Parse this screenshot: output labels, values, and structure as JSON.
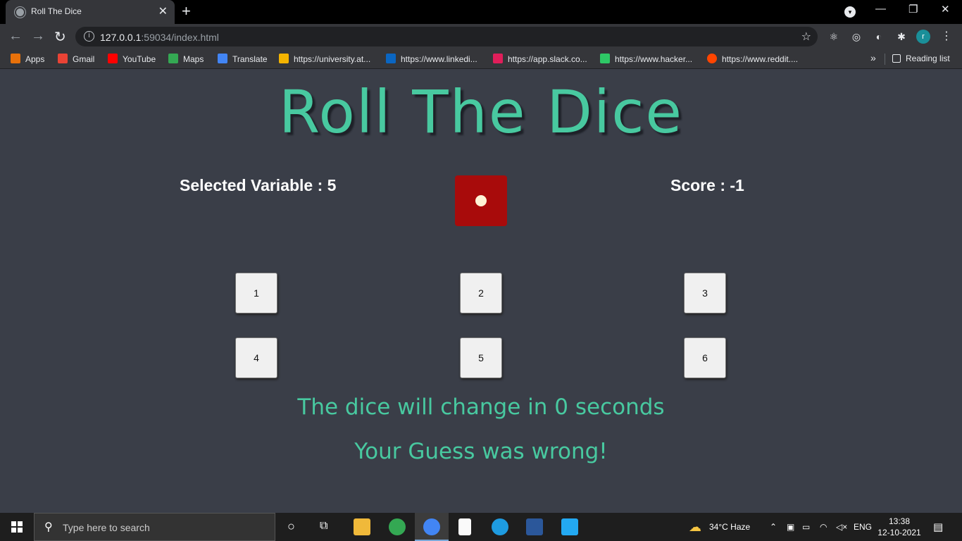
{
  "browser": {
    "tab_title": "Roll The Dice",
    "tab_close": "✕",
    "new_tab": "+",
    "url_host": "127.0.0.1",
    "url_rest": ":59034/index.html",
    "avatar_letter": "r",
    "reading_list": "Reading list",
    "overflow": "»",
    "bookmarks": [
      {
        "label": "Apps",
        "icon": "apps-grid-icon",
        "color": "#e8710a"
      },
      {
        "label": "Gmail",
        "icon": "gmail-icon",
        "color": "#ea4335"
      },
      {
        "label": "YouTube",
        "icon": "youtube-icon",
        "color": "#ff0000"
      },
      {
        "label": "Maps",
        "icon": "maps-icon",
        "color": "#34a853"
      },
      {
        "label": "Translate",
        "icon": "translate-icon",
        "color": "#4285f4"
      },
      {
        "label": "https://university.at...",
        "icon": "university-icon",
        "color": "#f4b400"
      },
      {
        "label": "https://www.linkedi...",
        "icon": "linkedin-icon",
        "color": "#0a66c2"
      },
      {
        "label": "https://app.slack.co...",
        "icon": "slack-icon",
        "color": "#e01e5a"
      },
      {
        "label": "https://www.hacker...",
        "icon": "hackerrank-icon",
        "color": "#2ec866"
      },
      {
        "label": "https://www.reddit....",
        "icon": "reddit-icon",
        "color": "#ff4500"
      }
    ]
  },
  "game": {
    "title": "Roll The Dice",
    "selected_variable": "Selected Variable : 5",
    "score": "Score : -1",
    "dice_value": 1,
    "buttons": [
      "1",
      "2",
      "3",
      "4",
      "5",
      "6"
    ],
    "timer_message": "The dice will change in 0 seconds",
    "result_message": "Your Guess was wrong!",
    "accent_color": "#48c9a0",
    "dice_color": "#a80b0b"
  },
  "taskbar": {
    "search_placeholder": "Type here to search",
    "weather": "34°C  Haze",
    "language": "ENG",
    "time": "13:38",
    "date": "12-10-2021"
  }
}
